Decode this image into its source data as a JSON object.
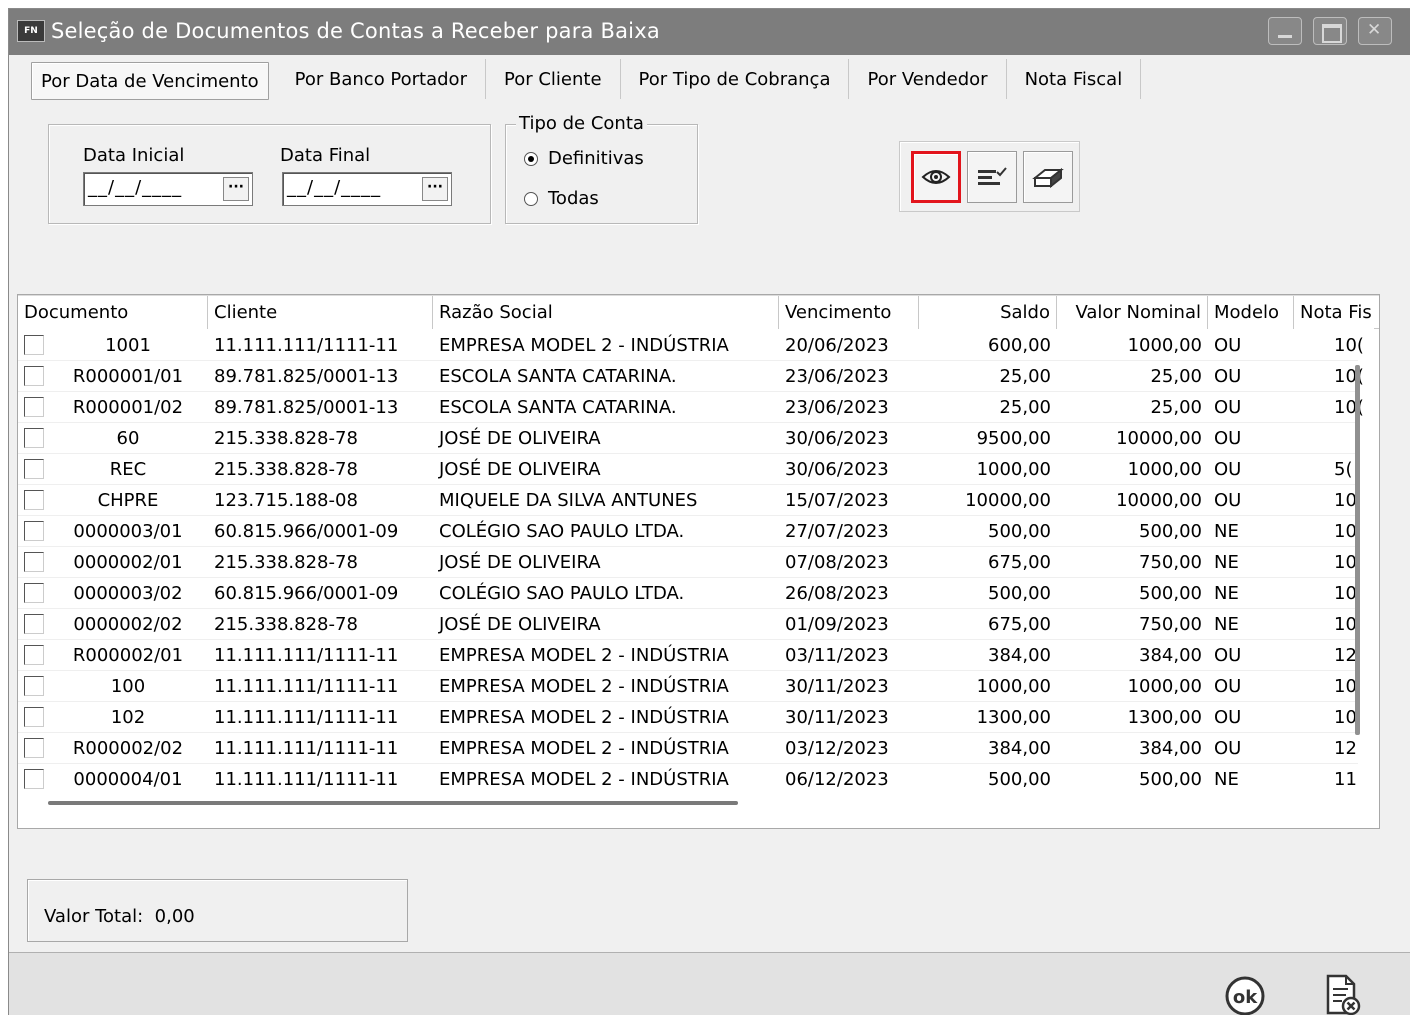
{
  "window": {
    "app_badge": "FN",
    "title": "Seleção de Documentos de Contas a Receber para Baixa"
  },
  "tabs": [
    {
      "label": "Por Data de Vencimento",
      "active": true
    },
    {
      "label": "Por Banco Portador",
      "active": false
    },
    {
      "label": "Por Cliente",
      "active": false
    },
    {
      "label": "Por Tipo de Cobrança",
      "active": false
    },
    {
      "label": "Por Vendedor",
      "active": false
    },
    {
      "label": "Nota Fiscal",
      "active": false
    }
  ],
  "filters": {
    "data_inicial_label": "Data Inicial",
    "data_final_label": "Data Final",
    "data_inicial_value": "__/__/____",
    "data_final_value": "__/__/____",
    "ellipsis": "···",
    "tipo_conta_legend": "Tipo de Conta",
    "opt_definitivas": "Definitivas",
    "opt_todas": "Todas",
    "selected": "Definitivas"
  },
  "toolbar": {
    "icons": [
      "eye-icon",
      "filter-list-icon",
      "eraser-icon"
    ],
    "highlight_color": "#e2141c"
  },
  "grid": {
    "columns": [
      "Documento",
      "Cliente",
      "Razão Social",
      "Vencimento",
      "Saldo",
      "Valor Nominal",
      "Modelo",
      "Nota Fis"
    ],
    "rows": [
      [
        "1001",
        "11.111.111/1111-11",
        "EMPRESA MODEL 2 - INDÚSTRIA",
        "20/06/2023",
        "600,00",
        "1000,00",
        "OU",
        "10("
      ],
      [
        "R000001/01",
        "89.781.825/0001-13",
        "ESCOLA SANTA CATARINA.",
        "23/06/2023",
        "25,00",
        "25,00",
        "OU",
        "10("
      ],
      [
        "R000001/02",
        "89.781.825/0001-13",
        "ESCOLA SANTA CATARINA.",
        "23/06/2023",
        "25,00",
        "25,00",
        "OU",
        "10("
      ],
      [
        "60",
        "215.338.828-78",
        "JOSÉ DE OLIVEIRA",
        "30/06/2023",
        "9500,00",
        "10000,00",
        "OU",
        ""
      ],
      [
        "REC",
        "215.338.828-78",
        "JOSÉ DE OLIVEIRA",
        "30/06/2023",
        "1000,00",
        "1000,00",
        "OU",
        "5("
      ],
      [
        "CHPRE",
        "123.715.188-08",
        "MIQUELE DA SILVA ANTUNES",
        "15/07/2023",
        "10000,00",
        "10000,00",
        "OU",
        "10"
      ],
      [
        "0000003/01",
        "60.815.966/0001-09",
        "COLÉGIO  SAO PAULO LTDA.",
        "27/07/2023",
        "500,00",
        "500,00",
        "NE",
        "10"
      ],
      [
        "0000002/01",
        "215.338.828-78",
        "JOSÉ DE OLIVEIRA",
        "07/08/2023",
        "675,00",
        "750,00",
        "NE",
        "10"
      ],
      [
        "0000003/02",
        "60.815.966/0001-09",
        "COLÉGIO  SAO PAULO LTDA.",
        "26/08/2023",
        "500,00",
        "500,00",
        "NE",
        "10"
      ],
      [
        "0000002/02",
        "215.338.828-78",
        "JOSÉ DE OLIVEIRA",
        "01/09/2023",
        "675,00",
        "750,00",
        "NE",
        "10"
      ],
      [
        "R000002/01",
        "11.111.111/1111-11",
        "EMPRESA MODEL 2 - INDÚSTRIA",
        "03/11/2023",
        "384,00",
        "384,00",
        "OU",
        "12"
      ],
      [
        "100",
        "11.111.111/1111-11",
        "EMPRESA MODEL 2 - INDÚSTRIA",
        "30/11/2023",
        "1000,00",
        "1000,00",
        "OU",
        "10"
      ],
      [
        "102",
        "11.111.111/1111-11",
        "EMPRESA MODEL 2 - INDÚSTRIA",
        "30/11/2023",
        "1300,00",
        "1300,00",
        "OU",
        "10"
      ],
      [
        "R000002/02",
        "11.111.111/1111-11",
        "EMPRESA MODEL 2 - INDÚSTRIA",
        "03/12/2023",
        "384,00",
        "384,00",
        "OU",
        "12"
      ],
      [
        "0000004/01",
        "11.111.111/1111-11",
        "EMPRESA MODEL 2 - INDÚSTRIA",
        "06/12/2023",
        "500,00",
        "500,00",
        "NE",
        "11"
      ]
    ]
  },
  "total": {
    "label": "Valor Total:",
    "value": "0,00"
  },
  "actions": {
    "ok_label": "ok",
    "exit_icon": "exit-document-icon"
  }
}
